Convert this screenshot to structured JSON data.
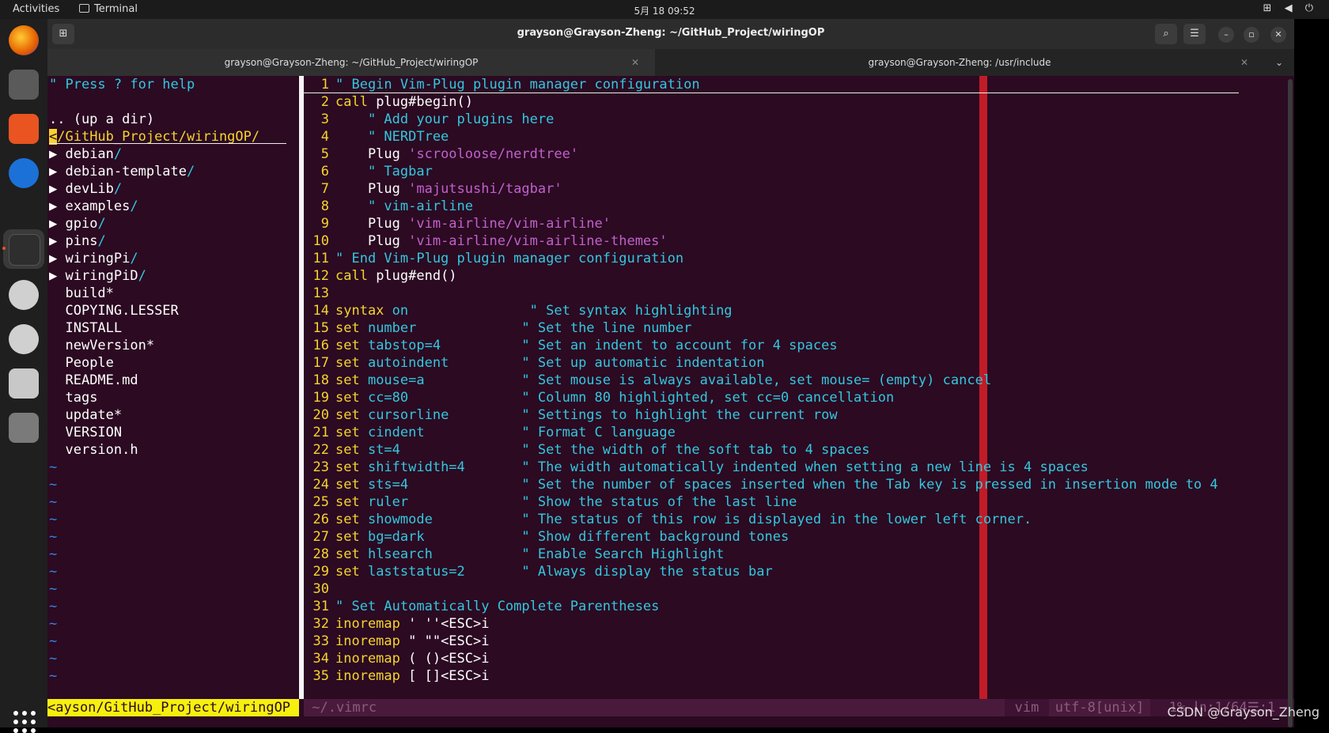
{
  "topbar": {
    "activities": "Activities",
    "app": "Terminal",
    "clock": "5月 18  09:52",
    "tray": "⊞ ◀ ⏻"
  },
  "window": {
    "title": "grayson@Grayson-Zheng: ~/GitHub_Project/wiringOP",
    "tabs": [
      {
        "label": "grayson@Grayson-Zheng: ~/GitHub_Project/wiringOP"
      },
      {
        "label": "grayson@Grayson-Zheng: /usr/include"
      }
    ]
  },
  "nerdtree": {
    "help": "\" Press ? for help",
    "updir": ".. (up a dir)",
    "cwd_cursor": "<",
    "cwd_rest": "/GitHub_Project/wiringOP/",
    "dirs": [
      "debian",
      "debian-template",
      "devLib",
      "examples",
      "gpio",
      "pins",
      "wiringPi",
      "wiringPiD"
    ],
    "files": [
      "build*",
      "COPYING.LESSER",
      "INSTALL",
      "newVersion*",
      "People",
      "README.md",
      "tags",
      "update*",
      "VERSION",
      "version.h"
    ],
    "tilde": "~"
  },
  "code": [
    {
      "n": "1",
      "k": "",
      "r": "\" Begin Vim-Plug plugin manager configuration",
      "t": "com"
    },
    {
      "n": "2",
      "k": "call",
      "r": " plug#begin()",
      "t": "call"
    },
    {
      "n": "3",
      "k": "",
      "r": "    \" Add your plugins here",
      "t": "com"
    },
    {
      "n": "4",
      "k": "",
      "r": "    \" NERDTree",
      "t": "com"
    },
    {
      "n": "5",
      "k": "    Plug",
      "r": " 'scrooloose/nerdtree'",
      "t": "plug"
    },
    {
      "n": "6",
      "k": "",
      "r": "    \" Tagbar",
      "t": "com"
    },
    {
      "n": "7",
      "k": "    Plug",
      "r": " 'majutsushi/tagbar'",
      "t": "plug"
    },
    {
      "n": "8",
      "k": "",
      "r": "    \" vim-airline",
      "t": "com"
    },
    {
      "n": "9",
      "k": "    Plug",
      "r": " 'vim-airline/vim-airline'",
      "t": "plug"
    },
    {
      "n": "10",
      "k": "    Plug",
      "r": " 'vim-airline/vim-airline-themes'",
      "t": "plug"
    },
    {
      "n": "11",
      "k": "",
      "r": "\" End Vim-Plug plugin manager configuration",
      "t": "com"
    },
    {
      "n": "12",
      "k": "call",
      "r": " plug#end()",
      "t": "call"
    },
    {
      "n": "13",
      "k": "",
      "r": "",
      "t": "blank"
    },
    {
      "n": "14",
      "k": "syntax",
      "o": " on",
      "c": "               \" Set syntax highlighting",
      "t": "set"
    },
    {
      "n": "15",
      "k": "set",
      "o": " number",
      "c": "             \" Set the line number",
      "t": "set"
    },
    {
      "n": "16",
      "k": "set",
      "o": " tabstop=4",
      "c": "          \" Set an indent to account for 4 spaces",
      "t": "set"
    },
    {
      "n": "17",
      "k": "set",
      "o": " autoindent",
      "c": "         \" Set up automatic indentation",
      "t": "set"
    },
    {
      "n": "18",
      "k": "set",
      "o": " mouse=a",
      "c": "            \" Set mouse is always available, set mouse= (empty) cancel",
      "t": "set"
    },
    {
      "n": "19",
      "k": "set",
      "o": " cc=80",
      "c": "              \" Column 80 highlighted, set cc=0 cancellation",
      "t": "set"
    },
    {
      "n": "20",
      "k": "set",
      "o": " cursorline",
      "c": "         \" Settings to highlight the current row",
      "t": "set"
    },
    {
      "n": "21",
      "k": "set",
      "o": " cindent",
      "c": "            \" Format C language",
      "t": "set"
    },
    {
      "n": "22",
      "k": "set",
      "o": " st=4",
      "c": "               \" Set the width of the soft tab to 4 spaces",
      "t": "set"
    },
    {
      "n": "23",
      "k": "set",
      "o": " shiftwidth=4",
      "c": "       \" The width automatically indented when setting a new line is 4 spaces",
      "t": "set"
    },
    {
      "n": "24",
      "k": "set",
      "o": " sts=4",
      "c": "              \" Set the number of spaces inserted when the Tab key is pressed in insertion mode to 4",
      "t": "set"
    },
    {
      "n": "25",
      "k": "set",
      "o": " ruler",
      "c": "              \" Show the status of the last line",
      "t": "set"
    },
    {
      "n": "26",
      "k": "set",
      "o": " showmode",
      "c": "           \" The status of this row is displayed in the lower left corner.",
      "t": "set"
    },
    {
      "n": "27",
      "k": "set",
      "o": " bg=dark",
      "c": "            \" Show different background tones",
      "t": "set"
    },
    {
      "n": "28",
      "k": "set",
      "o": " hlsearch",
      "c": "           \" Enable Search Highlight",
      "t": "set"
    },
    {
      "n": "29",
      "k": "set",
      "o": " laststatus=2",
      "c": "       \" Always display the status bar",
      "t": "set"
    },
    {
      "n": "30",
      "k": "",
      "r": "",
      "t": "blank"
    },
    {
      "n": "31",
      "k": "",
      "r": "\" Set Automatically Complete Parentheses",
      "t": "com"
    },
    {
      "n": "32",
      "k": "inoremap",
      "r": " ' ''<ESC>i",
      "t": "call"
    },
    {
      "n": "33",
      "k": "inoremap",
      "r": " \" \"\"<ESC>i",
      "t": "call"
    },
    {
      "n": "34",
      "k": "inoremap",
      "r": " ( ()<ESC>i",
      "t": "call"
    },
    {
      "n": "35",
      "k": "inoremap",
      "r": " [ []<ESC>i",
      "t": "call"
    }
  ],
  "status": {
    "left": "<ayson/GitHub_Project/wiringOP ",
    "file": " ~/.vimrc",
    "ft": "vim",
    "enc": "utf-8[unix]",
    "pos": "1% ㏑:1/64☰:1"
  },
  "watermark": "CSDN @Grayson_Zheng"
}
